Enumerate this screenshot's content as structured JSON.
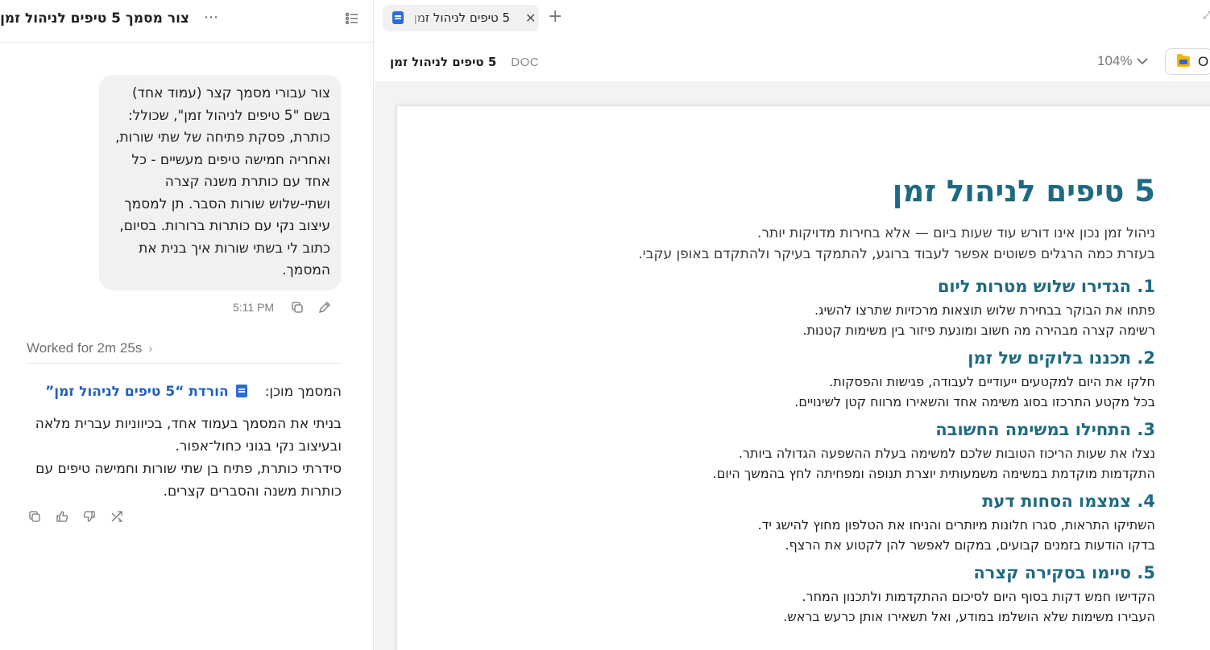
{
  "chat": {
    "title": "צור מסמך 5 טיפים לניהול זמן",
    "user_message": "צור עבורי מסמך קצר (עמוד אחד) בשם \"5 טיפים לניהול זמן\", שכולל: כותרת, פסקת פתיחה של שתי שורות, ואחריה חמישה טיפים מעשיים - כל אחד עם כותרת משנה קצרה ושתי-שלוש שורות הסבר. תן למסמך עיצוב נקי עם כותרות ברורות. בסיום, כתוב לי בשתי שורות איך בנית את המסמך.",
    "message_time": "5:11 PM",
    "worked_label": "Worked for 2m 25s",
    "ready_prefix": "המסמך מוכן:",
    "doc_link_label": "הורדת “5 טיפים לניהול זמן”",
    "assistant_lines": [
      "בניתי את המסמך בעמוד אחד, בכיווניות עברית מלאה ובעיצוב נקי בגוני כחול־אפור.",
      "סידרתי כותרת, פתיח בן שתי שורות וחמישה טיפים עם כותרות משנה והסברים קצרים."
    ]
  },
  "viewer": {
    "tab_label": "5 טיפים לניהול זמן",
    "doc_name": "5 טיפים לניהול זמן",
    "doc_type": "DOC",
    "zoom": "104%",
    "open_label": "O"
  },
  "document": {
    "title": "5 טיפים לניהול זמן",
    "intro": [
      "ניהול זמן נכון אינו דורש עוד שעות ביום — אלא בחירות מדויקות יותר.",
      "בעזרת כמה הרגלים פשוטים אפשר לעבוד ברוגע, להתמקד בעיקר ולהתקדם באופן עקבי."
    ],
    "tips": [
      {
        "title": "1. הגדירו שלוש מטרות ליום",
        "lines": [
          "פתחו את הבוקר בבחירת שלוש תוצאות מרכזיות שתרצו להשיג.",
          "רשימה קצרה מבהירה מה חשוב ומונעת פיזור בין משימות קטנות."
        ]
      },
      {
        "title": "2. תכננו בלוקים של זמן",
        "lines": [
          "חלקו את היום למקטעים ייעודיים לעבודה, פגישות והפסקות.",
          "בכל מקטע התרכזו בסוג משימה אחד והשאירו מרווח קטן לשינויים."
        ]
      },
      {
        "title": "3. התחילו במשימה החשובה",
        "lines": [
          "נצלו את שעות הריכוז הטובות שלכם למשימה בעלת ההשפעה הגדולה ביותר.",
          "התקדמות מוקדמת במשימה משמעותית יוצרת תנופה ומפחיתה לחץ בהמשך היום."
        ]
      },
      {
        "title": "4. צמצמו הסחות דעת",
        "lines": [
          "השתיקו התראות, סגרו חלונות מיותרים והניחו את הטלפון מחוץ להישג יד.",
          "בדקו הודעות בזמנים קבועים, במקום לאפשר להן לקטוע את הרצף."
        ]
      },
      {
        "title": "5. סיימו בסקירה קצרה",
        "lines": [
          "הקדישו חמש דקות בסוף היום לסיכום ההתקדמות ולתכנון המחר.",
          "העבירו משימות שלא הושלמו במודע, ואל תשאירו אותן כרעש בראש."
        ]
      }
    ]
  },
  "icons": {
    "more": "more-horizontal-icon",
    "outline": "outline-list-icon",
    "copy": "copy-icon",
    "edit": "edit-pencil-icon",
    "thumbs_up": "thumbs-up-icon",
    "thumbs_down": "thumbs-down-icon",
    "share": "share-icon",
    "doc": "word-doc-icon",
    "folder": "folder-icon"
  },
  "colors": {
    "accent": "#1e6a82",
    "link": "#1f5fbf",
    "doc_icon": "#2f6bd8"
  }
}
